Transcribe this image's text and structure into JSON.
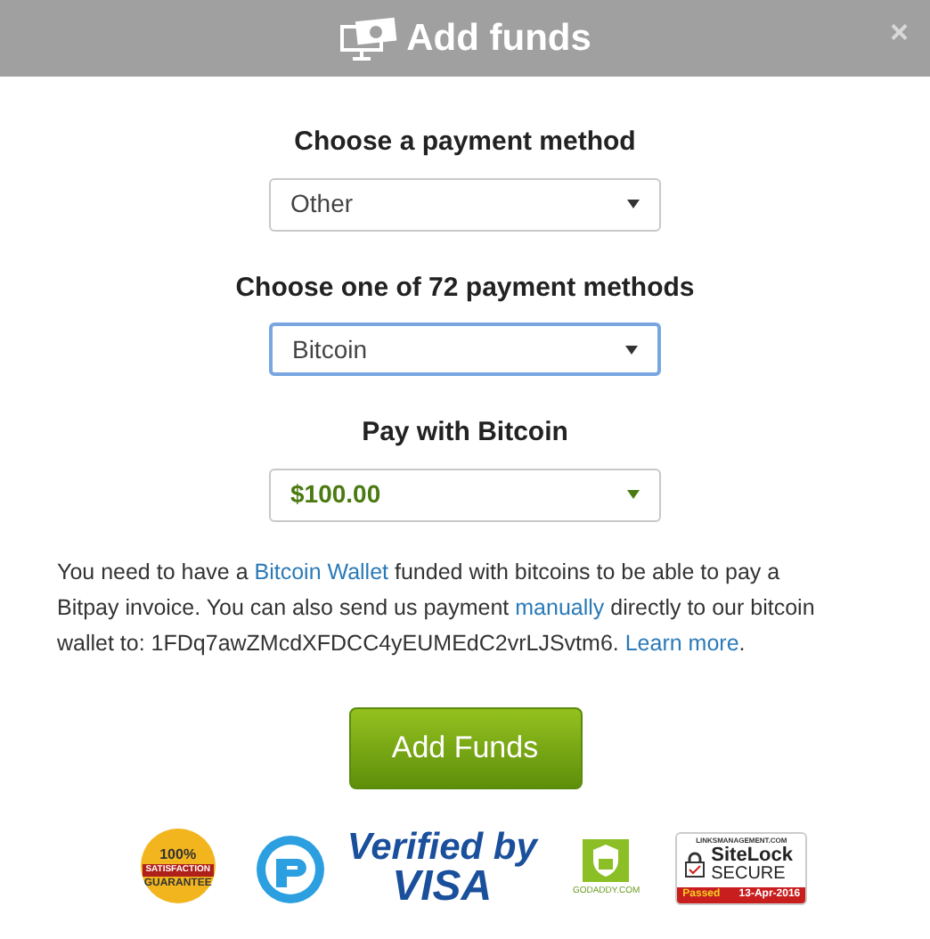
{
  "window": {
    "title": "Add funds",
    "close": "×"
  },
  "fields": [
    {
      "label": "Choose a payment method",
      "value": "Other",
      "focused": false,
      "kind": "plain"
    },
    {
      "label": "Choose one of 72 payment methods",
      "value": "Bitcoin",
      "focused": true,
      "kind": "plain"
    },
    {
      "label": "Pay with Bitcoin",
      "value": "$100.00",
      "focused": false,
      "kind": "amount"
    }
  ],
  "notice": [
    {
      "kind": "text",
      "text": "You need to have a "
    },
    {
      "kind": "link",
      "text": "Bitcoin Wallet"
    },
    {
      "kind": "text",
      "text": " funded with bitcoins to be able to pay a Bitpay invoice. You can also send us payment "
    },
    {
      "kind": "link",
      "text": "manually"
    },
    {
      "kind": "text",
      "text": " directly to our bitcoin wallet to: 1FDq7awZMcdXFDCC4yEUMEdC2vrLJSvtm6. "
    },
    {
      "kind": "link",
      "text": "Learn more"
    },
    {
      "kind": "text",
      "text": "."
    }
  ],
  "submit": "Add Funds",
  "badges": [
    {
      "kind": "satisfaction",
      "texts": [
        "100%",
        "SATISFACTION",
        "GUARANTEE"
      ]
    },
    {
      "kind": "paypro"
    },
    {
      "kind": "visa",
      "texts": [
        "Verified by",
        "VISA"
      ]
    },
    {
      "kind": "godaddy",
      "texts": [
        "GODADDY.COM"
      ]
    },
    {
      "kind": "sitelock",
      "texts": [
        "LINKSMANAGEMENT.COM",
        "SiteLock",
        "SECURE",
        "Passed",
        "13-Apr-2016"
      ]
    }
  ]
}
